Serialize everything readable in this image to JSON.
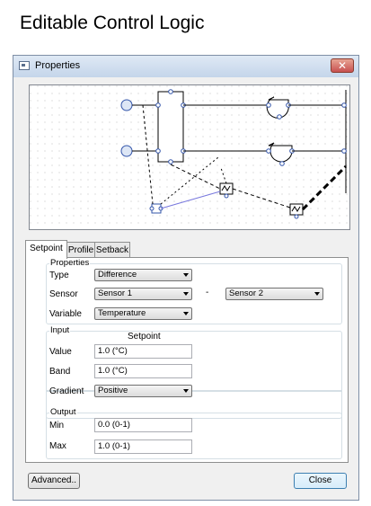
{
  "heading": "Editable Control Logic",
  "window": {
    "title": "Properties",
    "close_glyph": "✕"
  },
  "tabs": [
    {
      "label": "Setpoint",
      "active": true
    },
    {
      "label": "Profile",
      "active": false
    },
    {
      "label": "Setback",
      "active": false
    }
  ],
  "properties": {
    "group_label": "Properties",
    "type_label": "Type",
    "type_value": "Difference",
    "sensor_label": "Sensor",
    "sensor1_value": "Sensor 1",
    "separator": "-",
    "sensor2_value": "Sensor 2",
    "variable_label": "Variable",
    "variable_value": "Temperature"
  },
  "input": {
    "group_label": "Input",
    "column_header": "Setpoint",
    "value_label": "Value",
    "value_value": "1.0 (°C)",
    "band_label": "Band",
    "band_value": "1.0 (°C)",
    "gradient_label": "Gradient",
    "gradient_value": "Positive"
  },
  "output": {
    "group_label": "Output",
    "min_label": "Min",
    "min_value": "0.0 (0-1)",
    "max_label": "Max",
    "max_value": "1.0 (0-1)"
  },
  "buttons": {
    "advanced": "Advanced..",
    "close": "Close"
  },
  "colors": {
    "node_fill": "#dde6f5",
    "node_stroke": "#3355aa",
    "link_dash": "#000000",
    "link_blue": "#7777dd"
  },
  "icons": [
    "window-icon",
    "close-icon",
    "dropdown-arrow-icon",
    "fan-icon",
    "damper-icon",
    "sensor-icon",
    "controller-icon"
  ]
}
